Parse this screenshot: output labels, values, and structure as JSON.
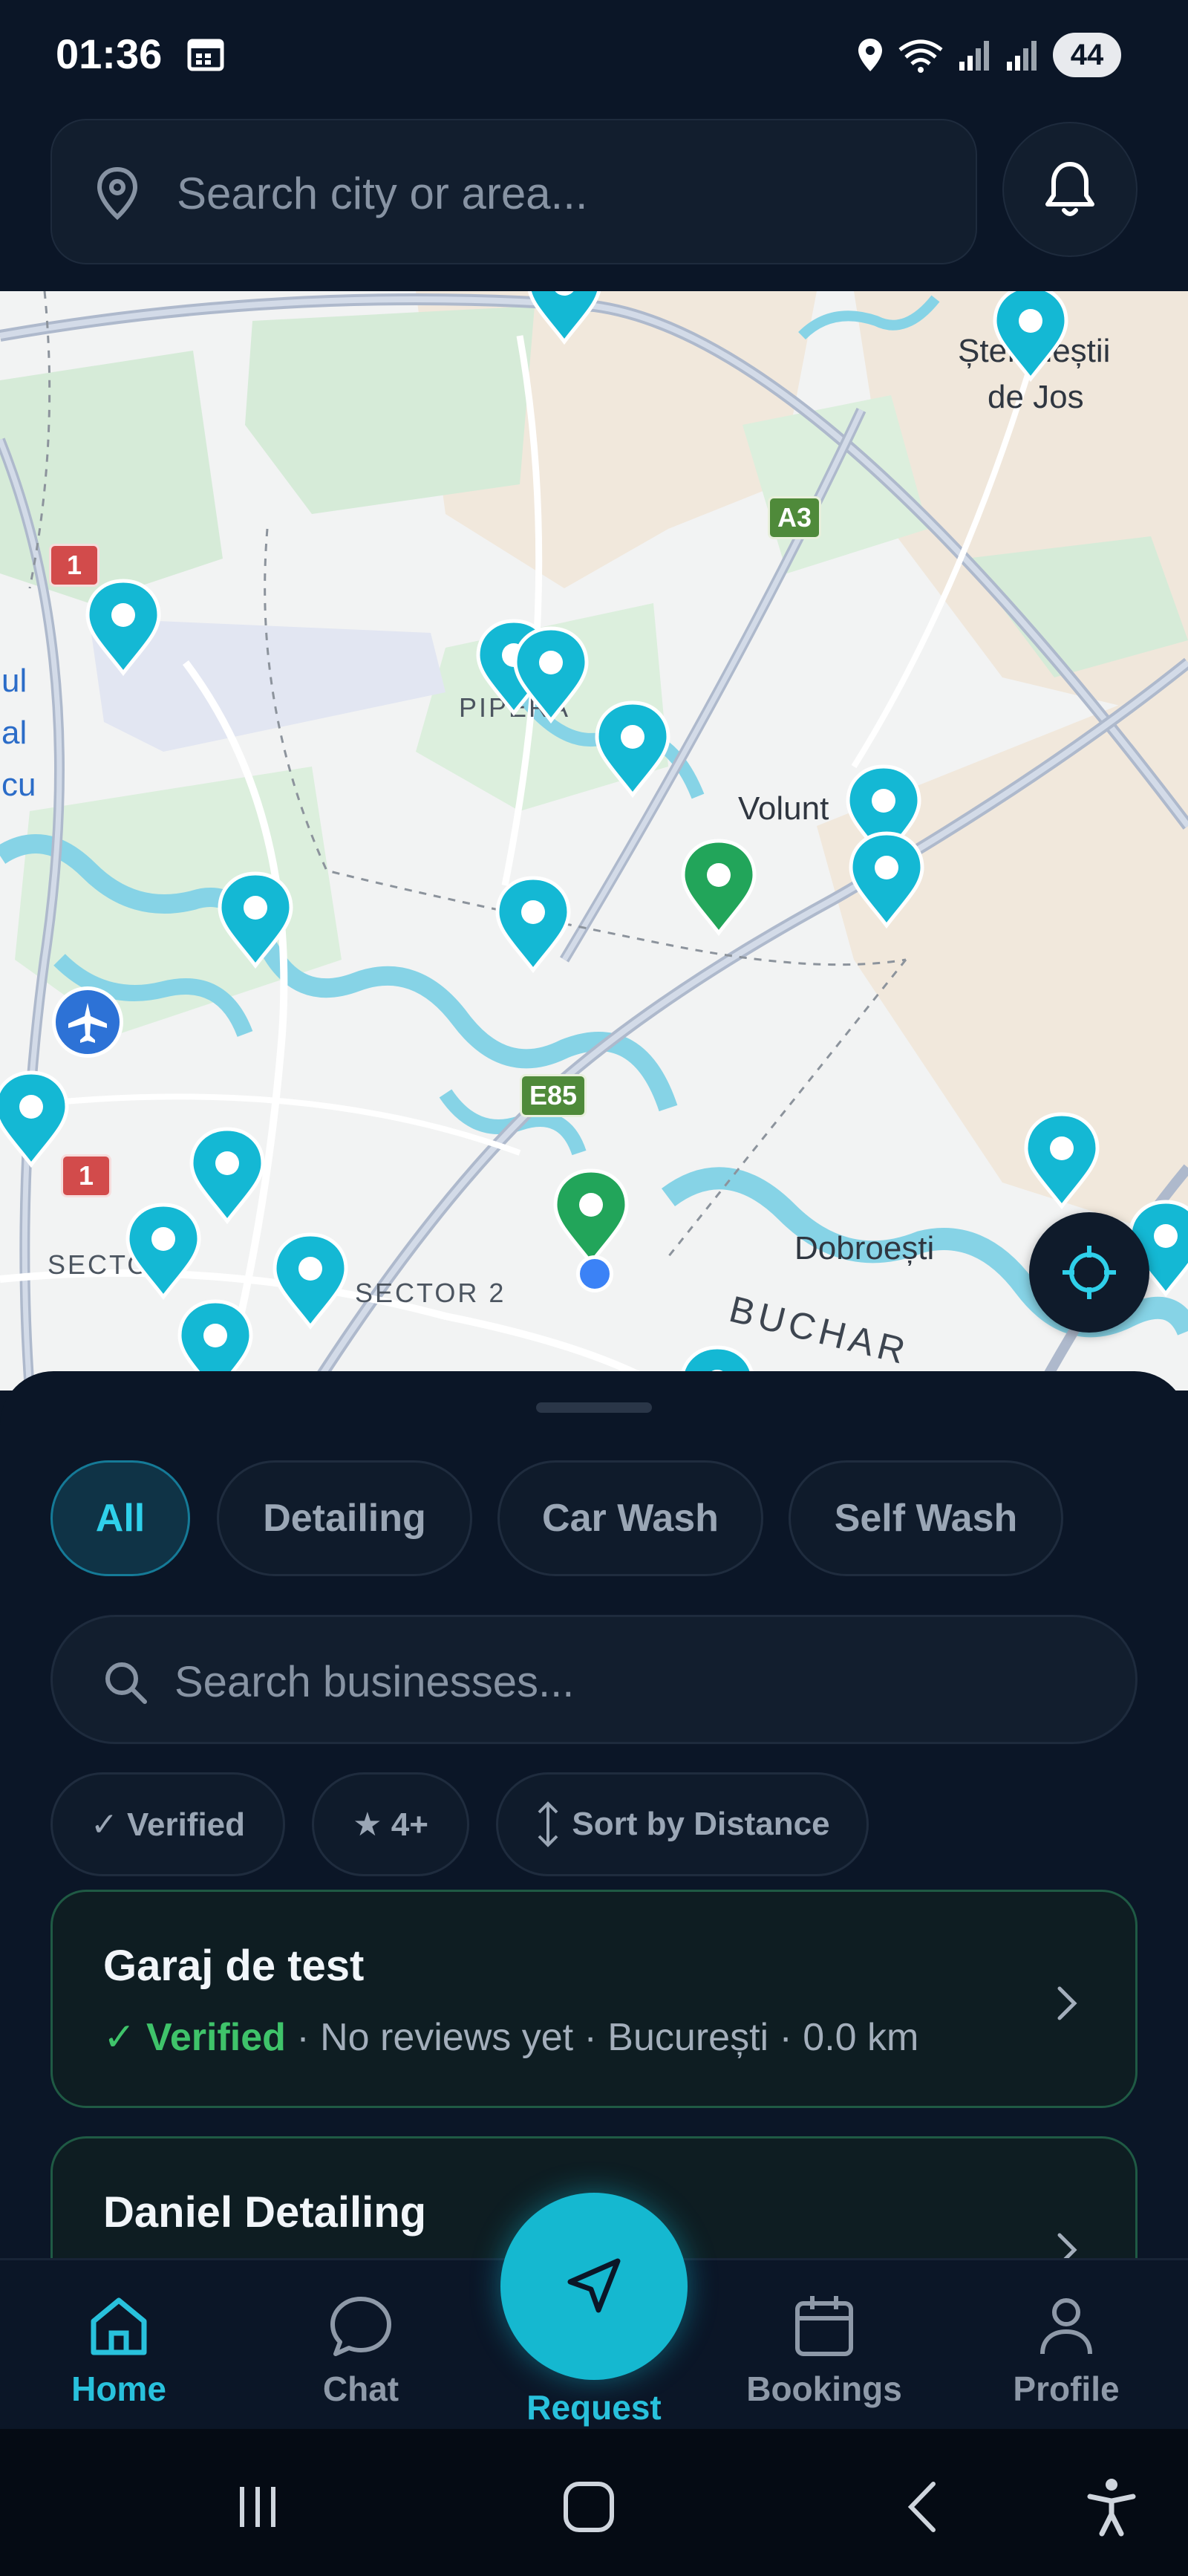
{
  "status_bar": {
    "time": "01:36",
    "battery": "44"
  },
  "header": {
    "search_placeholder": "Search city or area..."
  },
  "map": {
    "labels": {
      "stefanestii": "Ștefăneștii",
      "de_jos": "de Jos",
      "pipera": "PIPERA",
      "voluntari": "Volunt",
      "dobroesti": "Dobroești",
      "sector_2": "SECTOR 2",
      "sector_partial": "SECTO",
      "bucharest": "BUCHAR",
      "ul": "ul",
      "al": "al",
      "cu": "cu"
    },
    "shields": {
      "a3": "A3",
      "e85": "E85",
      "dn1_top": "1",
      "dn1_bottom": "1"
    },
    "colors": {
      "marker_teal": "#14b8d4",
      "marker_green": "#22a55a",
      "water": "#7ed3e6",
      "park": "#d7ecd9"
    }
  },
  "sheet": {
    "categories": [
      "All",
      "Detailing",
      "Car Wash",
      "Self Wash"
    ],
    "business_search_placeholder": "Search businesses...",
    "filters": {
      "verified": "✓ Verified",
      "rating": "★ 4+",
      "sort": "Sort by Distance"
    },
    "businesses": [
      {
        "name": "Garaj de test",
        "verified_label": "✓ Verified",
        "meta": " · No reviews yet · București · 0.0 km"
      },
      {
        "name": "Daniel Detailing"
      }
    ]
  },
  "bottom_nav": {
    "home": "Home",
    "chat": "Chat",
    "request": "Request",
    "bookings": "Bookings",
    "profile": "Profile"
  }
}
